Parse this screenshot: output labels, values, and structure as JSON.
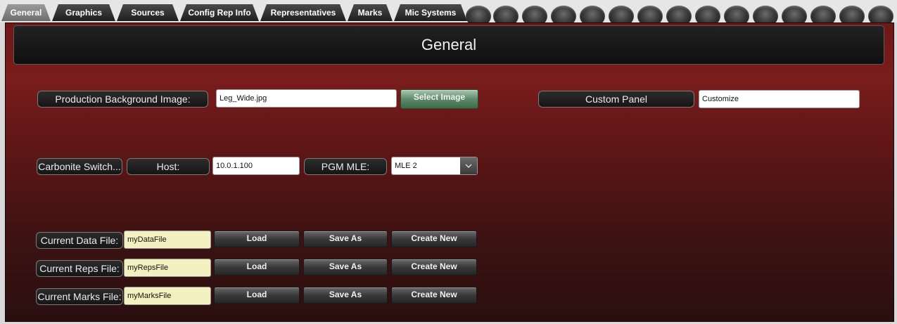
{
  "tabs": [
    {
      "label": "General",
      "active": true
    },
    {
      "label": "Graphics",
      "active": false
    },
    {
      "label": "Sources",
      "active": false
    },
    {
      "label": "Config Rep Info",
      "active": false
    },
    {
      "label": "Representatives",
      "active": false
    },
    {
      "label": "Marks",
      "active": false
    },
    {
      "label": "Mic Systems",
      "active": false
    }
  ],
  "header": {
    "title": "General"
  },
  "background": {
    "label": "Production Background Image:",
    "value": "Leg_Wide.jpg",
    "button": "Select Image"
  },
  "custom_panel": {
    "label": "Custom Panel",
    "value": "Customize"
  },
  "switcher": {
    "name": "Carbonite Switch...",
    "host_label": "Host:",
    "host_value": "10.0.1.100",
    "mle_label": "PGM MLE:",
    "mle_value": "MLE 2",
    "arrow_icon": "chevron-down-icon"
  },
  "files": [
    {
      "label": "Current Data File:",
      "value": "myDataFile",
      "load": "Load",
      "save": "Save As",
      "create": "Create New"
    },
    {
      "label": "Current Reps File:",
      "value": "myRepsFile",
      "load": "Load",
      "save": "Save As",
      "create": "Create New"
    },
    {
      "label": "Current Marks File:",
      "value": "myMarksFile",
      "load": "Load",
      "save": "Save As",
      "create": "Create New"
    }
  ],
  "colors": {
    "panel_red": "#701717",
    "panel_dark": "#2a0f0f",
    "field_yellow": "#f4f1c0",
    "button_green": "#5e8a6c"
  }
}
